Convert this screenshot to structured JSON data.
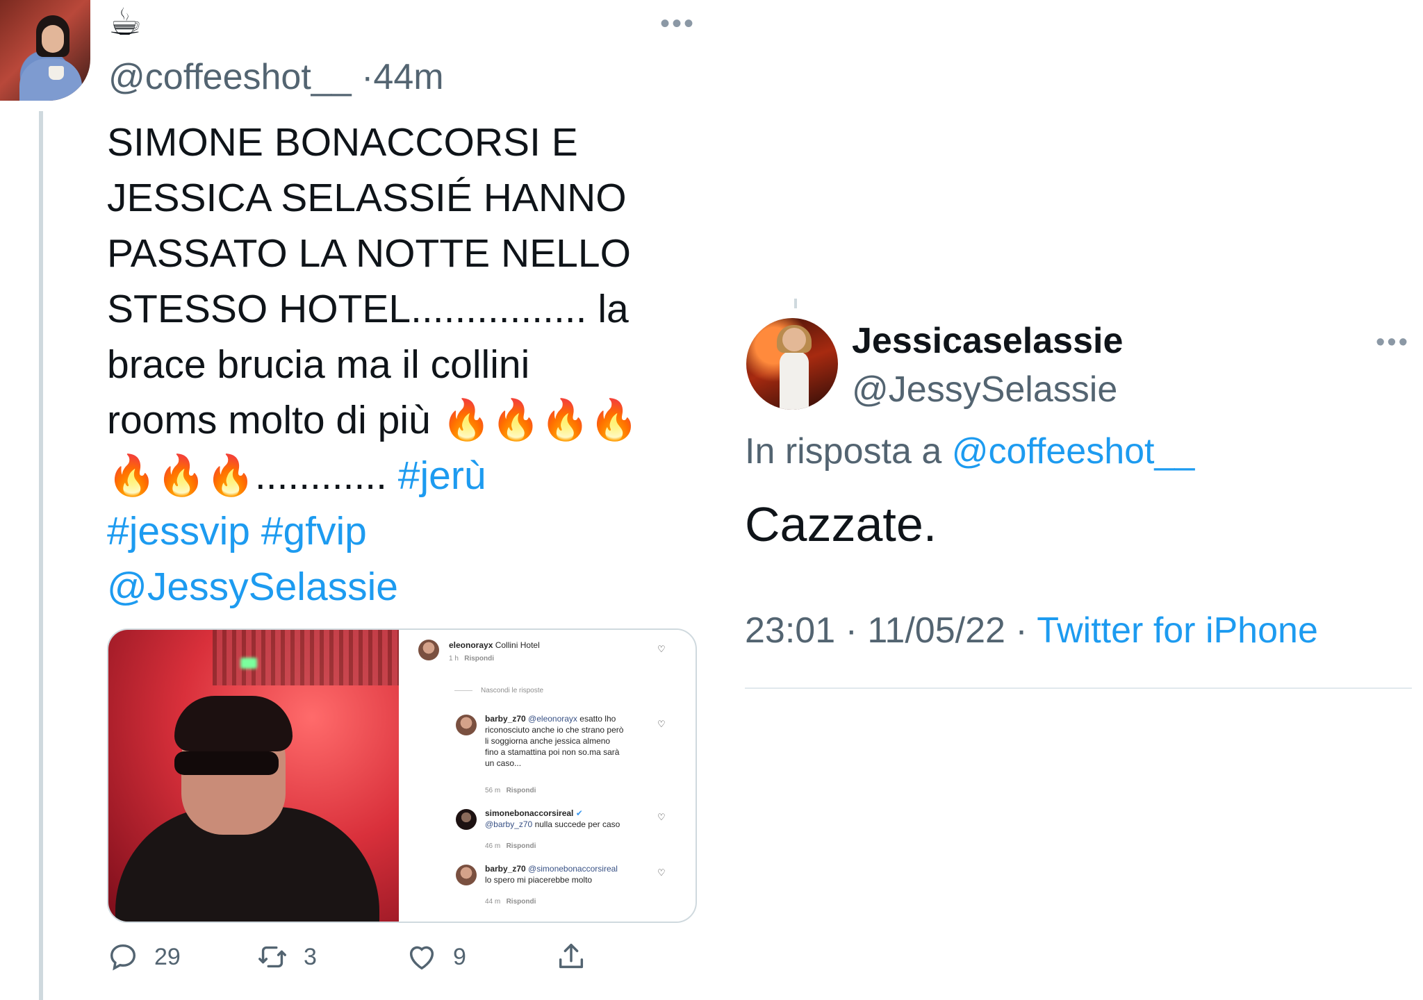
{
  "left_tweet": {
    "display_name_emoji": "☕",
    "handle": "@coffeeshot__",
    "separator": "·",
    "time": "44m",
    "text_lines": [
      "SIMONE BONACCORSI E",
      "JESSICA SELASSIÉ HANNO",
      "PASSATO LA NOTTE NELLO",
      "STESSO HOTEL................ la",
      "brace brucia ma il collini",
      "rooms molto di più 🔥🔥🔥🔥",
      "🔥🔥🔥............"
    ],
    "hashtag_jeru": "#jerù",
    "hashtag_jessvip": "#jessvip",
    "hashtag_gfvip": "#gfvip",
    "mention": "@JessySelassie",
    "more": "•••",
    "stats": {
      "replies": "29",
      "retweets": "3",
      "likes": "9"
    },
    "media": {
      "comments": [
        {
          "user": "eleonorayx",
          "text": "Collini Hotel",
          "time": "1 h",
          "reply": "Rispondi"
        },
        {
          "hide_replies": "Nascondi le risposte"
        },
        {
          "user": "barby_z70",
          "mention": "@eleonorayx",
          "text_lines": [
            "esatto lho",
            "riconosciuto anche io che strano però",
            "li soggiorna anche jessica almeno",
            "fino a stamattina poi non so.ma sarà",
            "un caso..."
          ],
          "time": "56 m",
          "reply": "Rispondi"
        },
        {
          "user": "simonebonaccorsireal",
          "verified": "✔",
          "mention": "@barby_z70",
          "text": "nulla succede per caso",
          "time": "46 m",
          "reply": "Rispondi"
        },
        {
          "user": "barby_z70",
          "mention": "@simonebonaccorsireal",
          "text": "lo spero mi piacerebbe molto",
          "time": "44 m",
          "reply": "Rispondi"
        }
      ]
    }
  },
  "right_tweet": {
    "display_name": "Jessicaselassie",
    "handle": "@JessySelassie",
    "more": "•••",
    "reply_prefix": "In risposta a",
    "reply_handle": "@coffeeshot__",
    "text": "Cazzate.",
    "time": "23:01",
    "date": "11/05/22",
    "dot": "·",
    "source": "Twitter for iPhone"
  }
}
